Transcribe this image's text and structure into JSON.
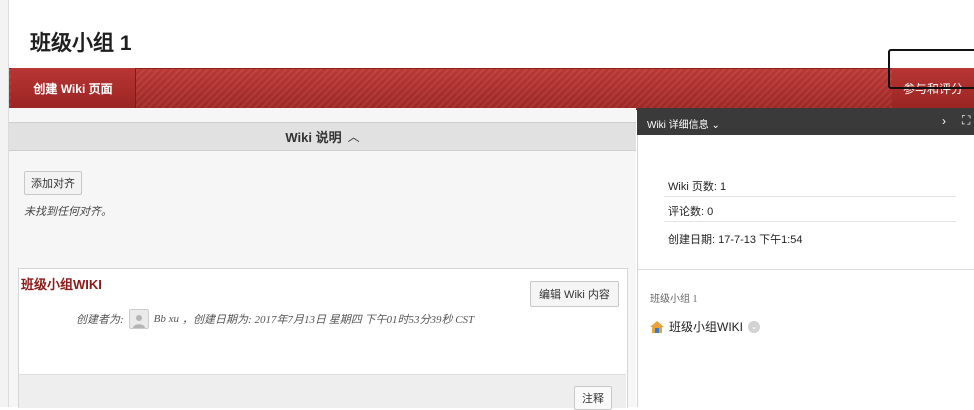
{
  "page": {
    "title": "班级小组 1"
  },
  "action_bar": {
    "create_label": "创建 Wiki 页面",
    "participate_label": "参与和评分"
  },
  "description": {
    "header": "Wiki 说明",
    "toggle_icon": "caret-up-icon",
    "add_alignment_label": "添加对齐",
    "no_alignment_text": "未找到任何对齐。"
  },
  "wiki_card": {
    "name": "班级小组WIKI",
    "edit_label": "编辑 Wiki 内容",
    "creator_prefix": "创建者为:",
    "creator_name": "Bb xu",
    "created_text": "，创建日期为: 2017年7月13日 星期四 下午01时53分39秒 CST",
    "comment_label": "注释"
  },
  "sidebar": {
    "header": "Wiki 详细信息",
    "page_count": "Wiki 页数: 1",
    "comment_count": "评论数: 0",
    "created_date": "创建日期: 17-7-13 下午1:54",
    "group_label": "班级小组 1",
    "group_wiki_link": "班级小组WIKI"
  },
  "colors": {
    "brand_red": "#a82c2a",
    "wiki_title_red": "#8b1a18",
    "side_header_bg": "#3a3a3a"
  }
}
